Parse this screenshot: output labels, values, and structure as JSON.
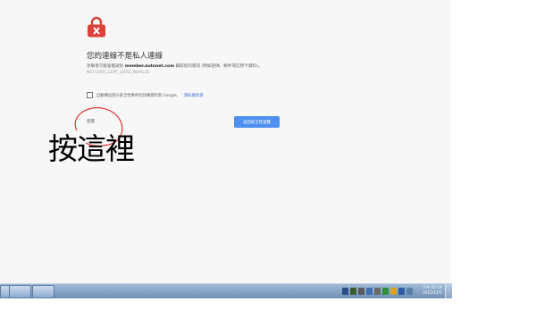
{
  "page": {
    "title": "您的連線不是私人連線",
    "description_prefix": "攻擊者可能會嘗試從",
    "site": "member.autonet.com",
    "description_suffix": "竊取您的資訊 (例如密碼、郵件或信用卡資料)。",
    "error_code": "NET::ERR_CERT_DATE_INVALID",
    "checkbox_text": "自動傳送部分安全性事件的詳細資料到 Google。",
    "privacy_link": "隱私權政策",
    "advanced_label": "進階",
    "back_button": "返回安全性瀏覽"
  },
  "annotation": {
    "text": "按這裡"
  },
  "taskbar": {
    "time": "下午 02:19",
    "date": "2015/12/5"
  },
  "colors": {
    "lock": "#d9413a",
    "button": "#4d90f0",
    "annotation_circle": "#e03a3a"
  },
  "icons": [
    "lock-icon",
    "start-button-icon",
    "explorer-icon",
    "chrome-icon",
    "tray-icons",
    "volume-icon"
  ]
}
